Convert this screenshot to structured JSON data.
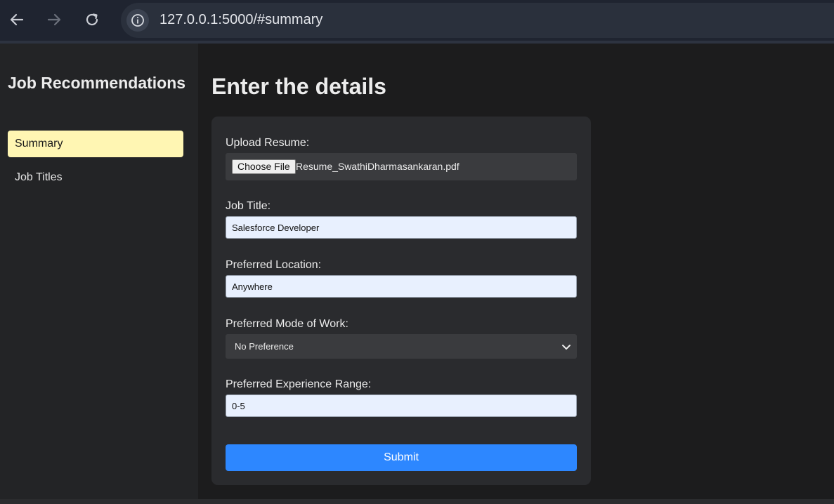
{
  "browser": {
    "url": "127.0.0.1:5000/#summary",
    "icons": [
      "back-arrow-icon",
      "forward-arrow-icon",
      "reload-icon",
      "info-icon"
    ]
  },
  "sidebar": {
    "title": "Job Recommendations",
    "items": [
      {
        "label": "Summary",
        "active": true
      },
      {
        "label": "Job Titles",
        "active": false
      }
    ],
    "active_color": "#fff6b3"
  },
  "main": {
    "title": "Enter the details",
    "form": {
      "resume_label": "Upload Resume:",
      "file_button": "Choose File",
      "file_name": "Resume_SwathiDharmasankaran.pdf",
      "job_title_label": "Job Title:",
      "job_title_value": "Salesforce Developer",
      "location_label": "Preferred Location:",
      "location_value": "Anywhere",
      "mode_label": "Preferred Mode of Work:",
      "mode_value": "No Preference",
      "experience_label": "Preferred Experience Range:",
      "experience_value": "0-5",
      "submit_label": "Submit",
      "submit_color": "#2d87ff"
    }
  }
}
